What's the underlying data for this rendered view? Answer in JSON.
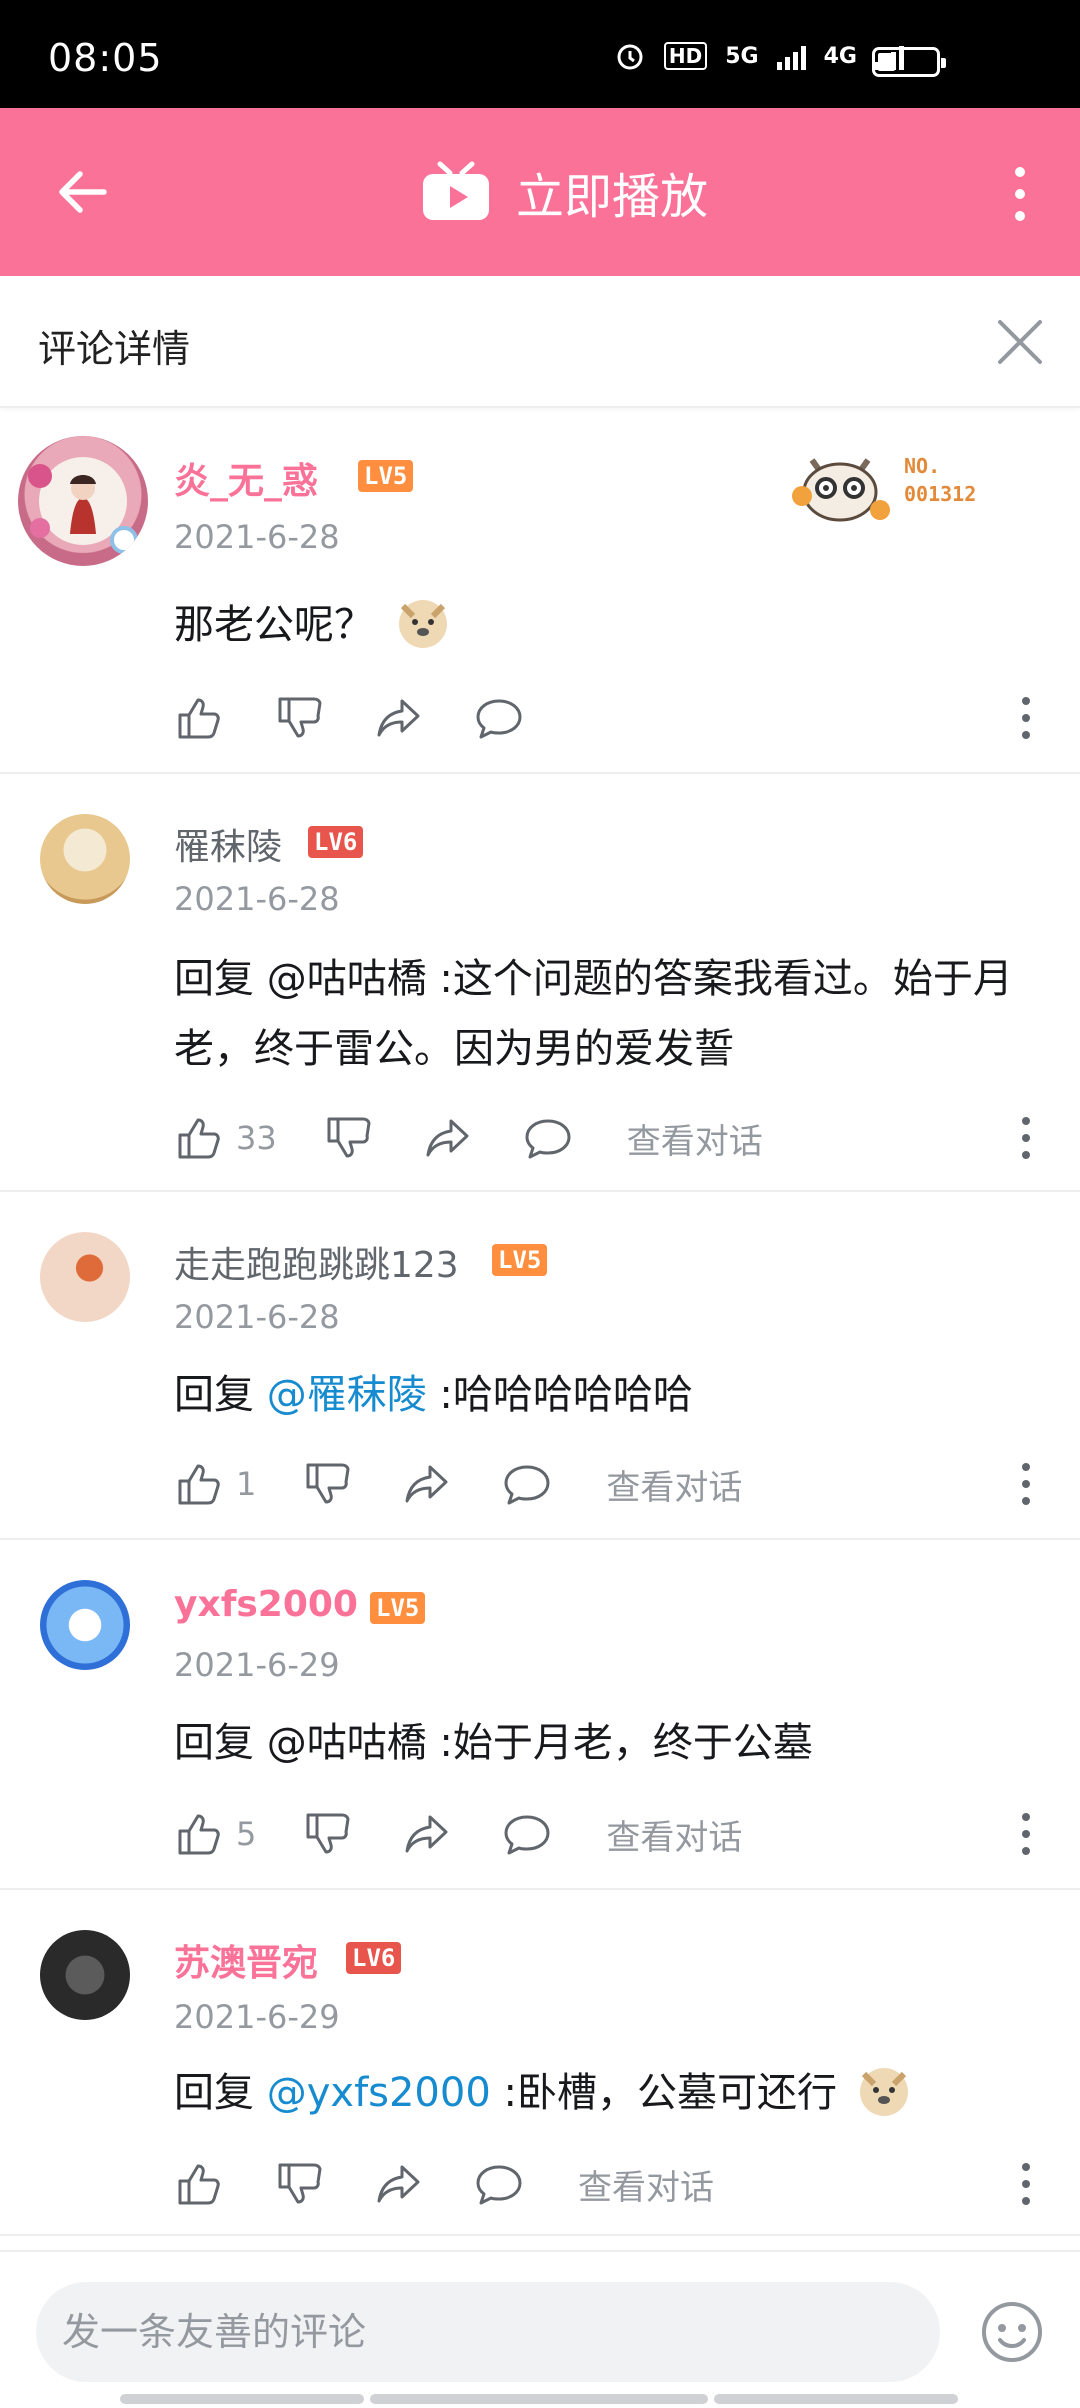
{
  "status": {
    "time": "08:05",
    "hd": "HD",
    "net1": "5G",
    "net2": "4G",
    "battery_percent": 30
  },
  "header": {
    "title": "立即播放"
  },
  "panel": {
    "title": "评论详情"
  },
  "badge": {
    "no": "NO.",
    "number": "001312"
  },
  "comments": [
    {
      "user": "炎_无_惑",
      "level": "LV5",
      "date": "2021-6-28",
      "text": "那老公呢？",
      "likes": ""
    },
    {
      "user": "罹秣陵",
      "level": "LV6",
      "date": "2021-6-28",
      "reply_prefix": "回复 ",
      "mention": "@咕咕橋",
      "text": " :这个问题的答案我看过。始于月老，终于雷公。因为男的爱发誓",
      "likes": "33",
      "view": "查看对话"
    },
    {
      "user": "走走跑跑跳跳123",
      "level": "LV5",
      "date": "2021-6-28",
      "reply_prefix": "回复 ",
      "mention": "@罹秣陵",
      "text": " :哈哈哈哈哈哈",
      "likes": "1",
      "view": "查看对话"
    },
    {
      "user": "yxfs2000",
      "level": "LV5",
      "date": "2021-6-29",
      "reply_prefix": "回复 ",
      "mention": "@咕咕橋",
      "text": " :始于月老，终于公墓",
      "likes": "5",
      "view": "查看对话"
    },
    {
      "user": "苏澳晋宛",
      "level": "LV6",
      "date": "2021-6-29",
      "reply_prefix": "回复 ",
      "mention": "@yxfs2000",
      "text": " :卧槽，公墓可还行",
      "likes": "",
      "view": "查看对话"
    }
  ],
  "input": {
    "placeholder": "发一条友善的评论"
  },
  "colors": {
    "brand_pink": "#fb7299",
    "mention_blue": "#178bcf",
    "lv5": "#ff8f3f",
    "lv6": "#e8554c"
  }
}
